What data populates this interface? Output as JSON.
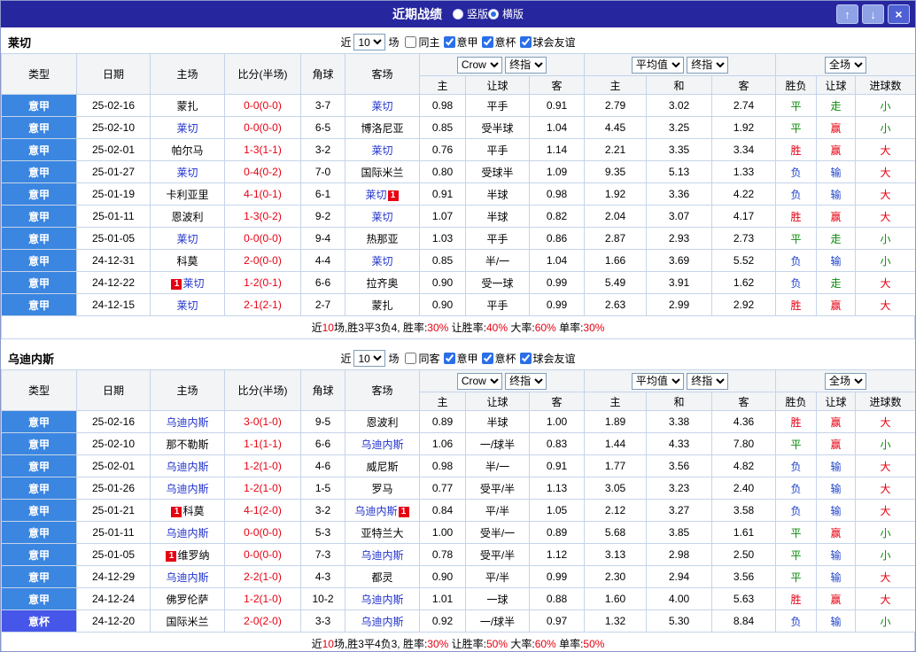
{
  "titlebar": {
    "title": "近期战绩",
    "radios": [
      {
        "key": "vertical",
        "label": "竖版",
        "selected": false
      },
      {
        "key": "horizontal",
        "label": "横版",
        "selected": true
      }
    ],
    "buttons": {
      "up": "↑",
      "down": "↓",
      "close": "×"
    }
  },
  "colors": {
    "score": "#e60012",
    "subject_team": "#2233cc",
    "badge_bg": "#e60012",
    "result_map": {
      "胜": "#e60012",
      "赢": "#e60012",
      "大": "#e60012",
      "平": "#0a8a0a",
      "走": "#0a8a0a",
      "小": "#0a8a0a",
      "负": "#2244cc",
      "输": "#2244cc"
    },
    "type_map": {
      "意甲": "#3b86e0",
      "意杯": "#4656e8"
    }
  },
  "header_labels": {
    "group_cols": [
      "类型",
      "日期",
      "主场",
      "比分(半场)",
      "角球",
      "客场"
    ],
    "sub_cols": [
      "主",
      "让球",
      "客",
      "主",
      "和",
      "客",
      "胜负",
      "让球",
      "进球数"
    ]
  },
  "tables": [
    {
      "team": "莱切",
      "controls": {
        "near": "近",
        "count": "10",
        "unit": "场",
        "checkboxes": [
          {
            "label": "同主",
            "checked": false
          },
          {
            "label": "意甲",
            "checked": true
          },
          {
            "label": "意杯",
            "checked": true
          },
          {
            "label": "球会友谊",
            "checked": true
          }
        ]
      },
      "dropdowns": [
        "Crow",
        "终指",
        "平均值",
        "终指",
        "全场"
      ],
      "rows": [
        {
          "type": "意甲",
          "date": "25-02-16",
          "home": "蒙扎",
          "home_subject": false,
          "score": "0-0(0-0)",
          "corners": "3-7",
          "away": "莱切",
          "away_subject": true,
          "o_home": "0.98",
          "o_hcap": "平手",
          "o_away": "0.91",
          "a_home": "2.79",
          "a_draw": "3.02",
          "a_away": "2.74",
          "r_result": "平",
          "r_hcap": "走",
          "r_goals": "小"
        },
        {
          "type": "意甲",
          "date": "25-02-10",
          "home": "莱切",
          "home_subject": true,
          "score": "0-0(0-0)",
          "corners": "6-5",
          "away": "博洛尼亚",
          "away_subject": false,
          "o_home": "0.85",
          "o_hcap": "受半球",
          "o_away": "1.04",
          "a_home": "4.45",
          "a_draw": "3.25",
          "a_away": "1.92",
          "r_result": "平",
          "r_hcap": "赢",
          "r_goals": "小"
        },
        {
          "type": "意甲",
          "date": "25-02-01",
          "home": "帕尔马",
          "home_subject": false,
          "score": "1-3(1-1)",
          "corners": "3-2",
          "away": "莱切",
          "away_subject": true,
          "o_home": "0.76",
          "o_hcap": "平手",
          "o_away": "1.14",
          "a_home": "2.21",
          "a_draw": "3.35",
          "a_away": "3.34",
          "r_result": "胜",
          "r_hcap": "赢",
          "r_goals": "大"
        },
        {
          "type": "意甲",
          "date": "25-01-27",
          "home": "莱切",
          "home_subject": true,
          "score": "0-4(0-2)",
          "corners": "7-0",
          "away": "国际米兰",
          "away_subject": false,
          "o_home": "0.80",
          "o_hcap": "受球半",
          "o_away": "1.09",
          "a_home": "9.35",
          "a_draw": "5.13",
          "a_away": "1.33",
          "r_result": "负",
          "r_hcap": "输",
          "r_goals": "大"
        },
        {
          "type": "意甲",
          "date": "25-01-19",
          "home": "卡利亚里",
          "home_subject": false,
          "score": "4-1(0-1)",
          "corners": "6-1",
          "away": "莱切",
          "away_subject": true,
          "away_post": "1",
          "o_home": "0.91",
          "o_hcap": "半球",
          "o_away": "0.98",
          "a_home": "1.92",
          "a_draw": "3.36",
          "a_away": "4.22",
          "r_result": "负",
          "r_hcap": "输",
          "r_goals": "大"
        },
        {
          "type": "意甲",
          "date": "25-01-11",
          "home": "恩波利",
          "home_subject": false,
          "score": "1-3(0-2)",
          "corners": "9-2",
          "away": "莱切",
          "away_subject": true,
          "o_home": "1.07",
          "o_hcap": "半球",
          "o_away": "0.82",
          "a_home": "2.04",
          "a_draw": "3.07",
          "a_away": "4.17",
          "r_result": "胜",
          "r_hcap": "赢",
          "r_goals": "大"
        },
        {
          "type": "意甲",
          "date": "25-01-05",
          "home": "莱切",
          "home_subject": true,
          "score": "0-0(0-0)",
          "corners": "9-4",
          "away": "热那亚",
          "away_subject": false,
          "o_home": "1.03",
          "o_hcap": "平手",
          "o_away": "0.86",
          "a_home": "2.87",
          "a_draw": "2.93",
          "a_away": "2.73",
          "r_result": "平",
          "r_hcap": "走",
          "r_goals": "小"
        },
        {
          "type": "意甲",
          "date": "24-12-31",
          "home": "科莫",
          "home_subject": false,
          "score": "2-0(0-0)",
          "corners": "4-4",
          "away": "莱切",
          "away_subject": true,
          "o_home": "0.85",
          "o_hcap": "半/一",
          "o_away": "1.04",
          "a_home": "1.66",
          "a_draw": "3.69",
          "a_away": "5.52",
          "r_result": "负",
          "r_hcap": "输",
          "r_goals": "小"
        },
        {
          "type": "意甲",
          "date": "24-12-22",
          "home": "莱切",
          "home_subject": true,
          "home_pre": "1",
          "score": "1-2(0-1)",
          "corners": "6-6",
          "away": "拉齐奥",
          "away_subject": false,
          "o_home": "0.90",
          "o_hcap": "受一球",
          "o_away": "0.99",
          "a_home": "5.49",
          "a_draw": "3.91",
          "a_away": "1.62",
          "r_result": "负",
          "r_hcap": "走",
          "r_goals": "大"
        },
        {
          "type": "意甲",
          "date": "24-12-15",
          "home": "莱切",
          "home_subject": true,
          "score": "2-1(2-1)",
          "corners": "2-7",
          "away": "蒙扎",
          "away_subject": false,
          "o_home": "0.90",
          "o_hcap": "平手",
          "o_away": "0.99",
          "a_home": "2.63",
          "a_draw": "2.99",
          "a_away": "2.92",
          "r_result": "胜",
          "r_hcap": "赢",
          "r_goals": "大"
        }
      ],
      "summary": [
        {
          "text": "近"
        },
        {
          "text": "10",
          "red": true
        },
        {
          "text": "场,胜3平3负4, 胜率:"
        },
        {
          "text": "30%",
          "red": true
        },
        {
          "text": " 让胜率:"
        },
        {
          "text": "40%",
          "red": true
        },
        {
          "text": " 大率:"
        },
        {
          "text": "60%",
          "red": true
        },
        {
          "text": " 单率:"
        },
        {
          "text": "30%",
          "red": true
        }
      ]
    },
    {
      "team": "乌迪内斯",
      "controls": {
        "near": "近",
        "count": "10",
        "unit": "场",
        "checkboxes": [
          {
            "label": "同客",
            "checked": false
          },
          {
            "label": "意甲",
            "checked": true
          },
          {
            "label": "意杯",
            "checked": true
          },
          {
            "label": "球会友谊",
            "checked": true
          }
        ]
      },
      "dropdowns": [
        "Crow",
        "终指",
        "平均值",
        "终指",
        "全场"
      ],
      "rows": [
        {
          "type": "意甲",
          "date": "25-02-16",
          "home": "乌迪内斯",
          "home_subject": true,
          "score": "3-0(1-0)",
          "corners": "9-5",
          "away": "恩波利",
          "away_subject": false,
          "o_home": "0.89",
          "o_hcap": "半球",
          "o_away": "1.00",
          "a_home": "1.89",
          "a_draw": "3.38",
          "a_away": "4.36",
          "r_result": "胜",
          "r_hcap": "赢",
          "r_goals": "大"
        },
        {
          "type": "意甲",
          "date": "25-02-10",
          "home": "那不勒斯",
          "home_subject": false,
          "score": "1-1(1-1)",
          "corners": "6-6",
          "away": "乌迪内斯",
          "away_subject": true,
          "o_home": "1.06",
          "o_hcap": "一/球半",
          "o_away": "0.83",
          "a_home": "1.44",
          "a_draw": "4.33",
          "a_away": "7.80",
          "r_result": "平",
          "r_hcap": "赢",
          "r_goals": "小"
        },
        {
          "type": "意甲",
          "date": "25-02-01",
          "home": "乌迪内斯",
          "home_subject": true,
          "score": "1-2(1-0)",
          "corners": "4-6",
          "away": "威尼斯",
          "away_subject": false,
          "o_home": "0.98",
          "o_hcap": "半/一",
          "o_away": "0.91",
          "a_home": "1.77",
          "a_draw": "3.56",
          "a_away": "4.82",
          "r_result": "负",
          "r_hcap": "输",
          "r_goals": "大"
        },
        {
          "type": "意甲",
          "date": "25-01-26",
          "home": "乌迪内斯",
          "home_subject": true,
          "score": "1-2(1-0)",
          "corners": "1-5",
          "away": "罗马",
          "away_subject": false,
          "o_home": "0.77",
          "o_hcap": "受平/半",
          "o_away": "1.13",
          "a_home": "3.05",
          "a_draw": "3.23",
          "a_away": "2.40",
          "r_result": "负",
          "r_hcap": "输",
          "r_goals": "大"
        },
        {
          "type": "意甲",
          "date": "25-01-21",
          "home": "科莫",
          "home_subject": false,
          "home_pre": "1",
          "score": "4-1(2-0)",
          "corners": "3-2",
          "away": "乌迪内斯",
          "away_subject": true,
          "away_post": "1",
          "o_home": "0.84",
          "o_hcap": "平/半",
          "o_away": "1.05",
          "a_home": "2.12",
          "a_draw": "3.27",
          "a_away": "3.58",
          "r_result": "负",
          "r_hcap": "输",
          "r_goals": "大"
        },
        {
          "type": "意甲",
          "date": "25-01-11",
          "home": "乌迪内斯",
          "home_subject": true,
          "score": "0-0(0-0)",
          "corners": "5-3",
          "away": "亚特兰大",
          "away_subject": false,
          "o_home": "1.00",
          "o_hcap": "受半/一",
          "o_away": "0.89",
          "a_home": "5.68",
          "a_draw": "3.85",
          "a_away": "1.61",
          "r_result": "平",
          "r_hcap": "赢",
          "r_goals": "小"
        },
        {
          "type": "意甲",
          "date": "25-01-05",
          "home": "维罗纳",
          "home_subject": false,
          "home_pre": "1",
          "score": "0-0(0-0)",
          "corners": "7-3",
          "away": "乌迪内斯",
          "away_subject": true,
          "o_home": "0.78",
          "o_hcap": "受平/半",
          "o_away": "1.12",
          "a_home": "3.13",
          "a_draw": "2.98",
          "a_away": "2.50",
          "r_result": "平",
          "r_hcap": "输",
          "r_goals": "小"
        },
        {
          "type": "意甲",
          "date": "24-12-29",
          "home": "乌迪内斯",
          "home_subject": true,
          "score": "2-2(1-0)",
          "corners": "4-3",
          "away": "都灵",
          "away_subject": false,
          "o_home": "0.90",
          "o_hcap": "平/半",
          "o_away": "0.99",
          "a_home": "2.30",
          "a_draw": "2.94",
          "a_away": "3.56",
          "r_result": "平",
          "r_hcap": "输",
          "r_goals": "大"
        },
        {
          "type": "意甲",
          "date": "24-12-24",
          "home": "佛罗伦萨",
          "home_subject": false,
          "score": "1-2(1-0)",
          "corners": "10-2",
          "away": "乌迪内斯",
          "away_subject": true,
          "o_home": "1.01",
          "o_hcap": "一球",
          "o_away": "0.88",
          "a_home": "1.60",
          "a_draw": "4.00",
          "a_away": "5.63",
          "r_result": "胜",
          "r_hcap": "赢",
          "r_goals": "大"
        },
        {
          "type": "意杯",
          "date": "24-12-20",
          "home": "国际米兰",
          "home_subject": false,
          "score": "2-0(2-0)",
          "corners": "3-3",
          "away": "乌迪内斯",
          "away_subject": true,
          "o_home": "0.92",
          "o_hcap": "一/球半",
          "o_away": "0.97",
          "a_home": "1.32",
          "a_draw": "5.30",
          "a_away": "8.84",
          "r_result": "负",
          "r_hcap": "输",
          "r_goals": "小"
        }
      ],
      "summary": [
        {
          "text": "近"
        },
        {
          "text": "10",
          "red": true
        },
        {
          "text": "场,胜3平4负3, 胜率:"
        },
        {
          "text": "30%",
          "red": true
        },
        {
          "text": " 让胜率:"
        },
        {
          "text": "50%",
          "red": true
        },
        {
          "text": " 大率:"
        },
        {
          "text": "60%",
          "red": true
        },
        {
          "text": " 单率:"
        },
        {
          "text": "50%",
          "red": true
        }
      ]
    }
  ]
}
